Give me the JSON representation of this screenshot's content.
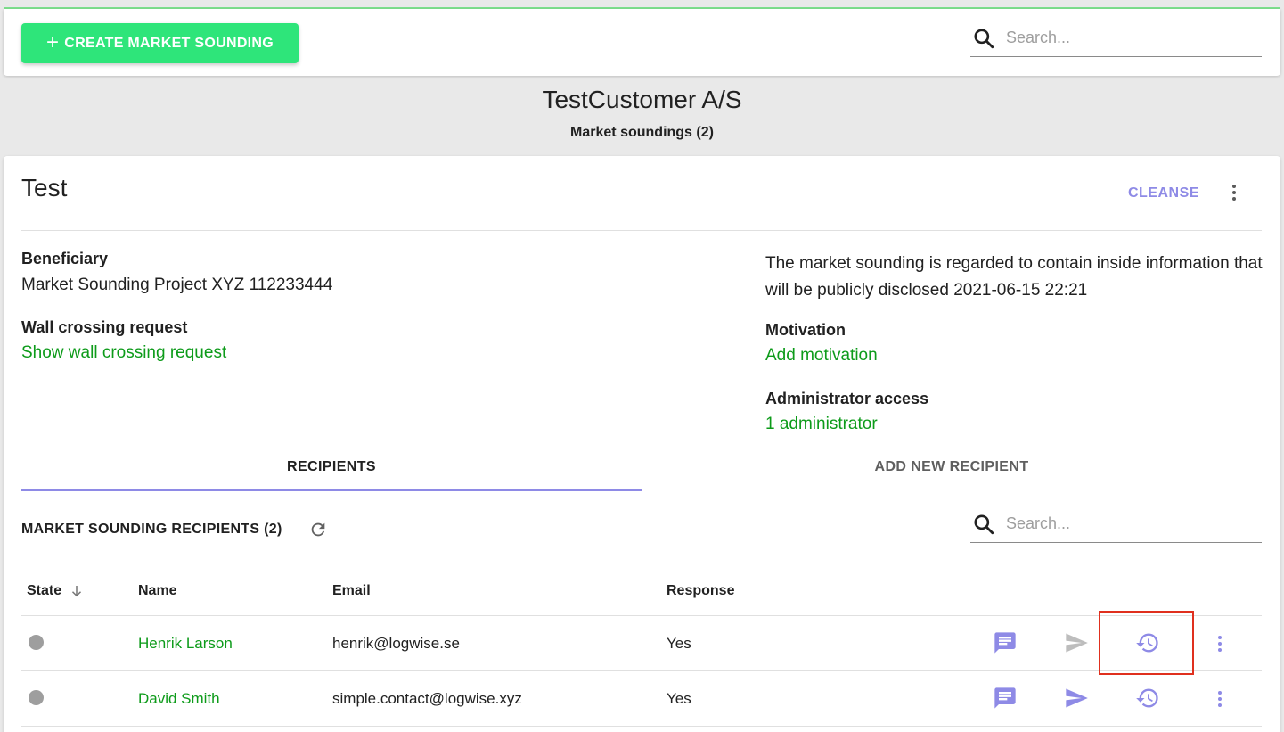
{
  "toolbar": {
    "create_label": "CREATE MARKET SOUNDING",
    "search_placeholder": "Search..."
  },
  "header": {
    "customer_name": "TestCustomer A/S",
    "soundings_count": "Market soundings (2)"
  },
  "card": {
    "title": "Test",
    "cleanse_label": "CLEANSE",
    "beneficiary_label": "Beneficiary",
    "beneficiary_value": "Market Sounding Project XYZ 112233444",
    "wall_crossing_label": "Wall crossing request",
    "wall_crossing_link": "Show wall crossing request",
    "inside_info_text": "The market sounding is regarded to contain inside information that will be publicly disclosed 2021-06-15 22:21",
    "motivation_label": "Motivation",
    "motivation_link": "Add motivation",
    "admin_label": "Administrator access",
    "admin_link": "1 administrator"
  },
  "tabs": {
    "recipients": "RECIPIENTS",
    "add_new": "ADD NEW RECIPIENT",
    "active": "recipients"
  },
  "recipients": {
    "section_title": "MARKET SOUNDING RECIPIENTS (2)",
    "search_placeholder": "Search...",
    "columns": {
      "state": "State",
      "name": "Name",
      "email": "Email",
      "response": "Response"
    },
    "rows": [
      {
        "name": "Henrik Larson",
        "email": "henrik@logwise.se",
        "response": "Yes",
        "state_color": "#9e9e9e",
        "send_enabled": false
      },
      {
        "name": "David Smith",
        "email": "simple.contact@logwise.xyz",
        "response": "Yes",
        "state_color": "#9e9e9e",
        "send_enabled": true
      }
    ]
  },
  "icons": {
    "search": "search-icon",
    "refresh": "refresh-icon",
    "sort": "arrow-down-icon",
    "message": "message-icon",
    "send": "send-icon",
    "history": "history-icon",
    "more": "more-vert-icon"
  },
  "colors": {
    "primary_green": "#2ee57a",
    "link_green": "#0d9b1a",
    "accent_purple": "#8e8ae6",
    "send_disabled": "#bdbdbd",
    "highlight_red": "#e0301e"
  }
}
